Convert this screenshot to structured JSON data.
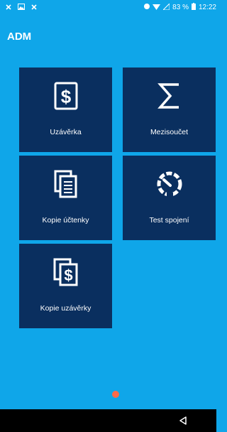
{
  "status_bar": {
    "left_icons": [
      "close-notification-icon",
      "image-notification-icon",
      "close-notification-icon"
    ],
    "battery_percent": "83 %",
    "time": "12:22"
  },
  "header": {
    "title": "ADM"
  },
  "tiles": [
    {
      "label": "Uzávěrka",
      "icon": "dollar-document-icon"
    },
    {
      "label": "Mezisoučet",
      "icon": "sigma-icon"
    },
    {
      "label": "Kopie účtenky",
      "icon": "receipt-copy-icon"
    },
    {
      "label": "Test spojení",
      "icon": "speedometer-icon"
    },
    {
      "label": "Kopie uzávěrky",
      "icon": "dollar-copy-icon"
    }
  ],
  "colors": {
    "background": "#0fa6e9",
    "tile": "#0a2f5f",
    "page_indicator": "#ff6b4a",
    "nav_bar": "#000000"
  }
}
